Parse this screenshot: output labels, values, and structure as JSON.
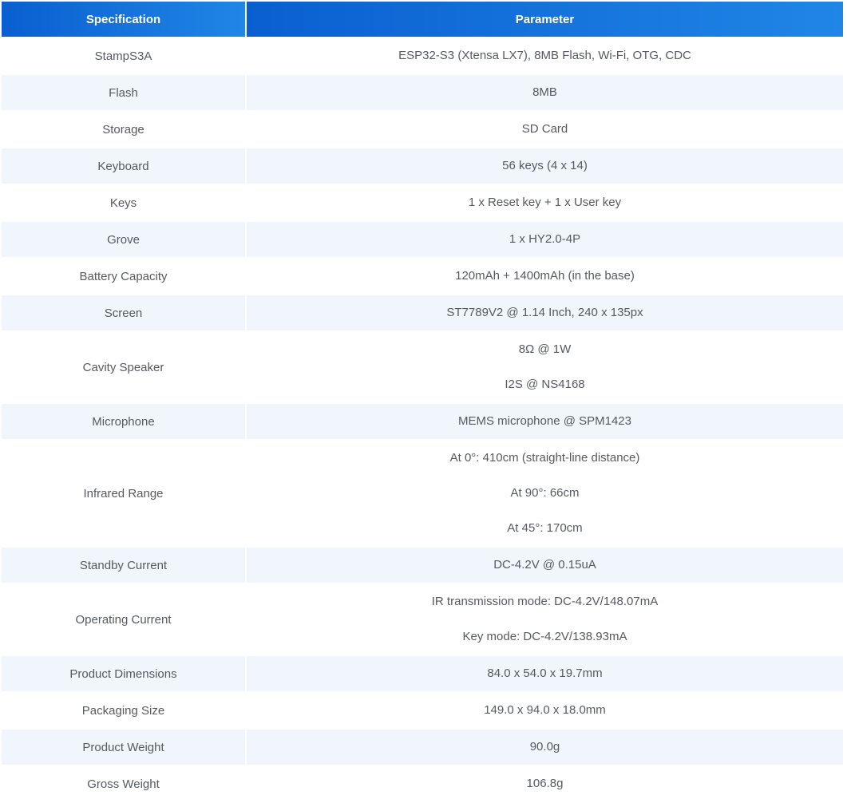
{
  "header": {
    "col1": "Specification",
    "col2": "Parameter"
  },
  "rows": [
    {
      "spec": "StampS3A",
      "params": [
        "ESP32-S3 (Xtensa LX7), 8MB Flash, Wi-Fi, OTG, CDC"
      ]
    },
    {
      "spec": "Flash",
      "params": [
        "8MB"
      ]
    },
    {
      "spec": "Storage",
      "params": [
        "SD Card"
      ]
    },
    {
      "spec": "Keyboard",
      "params": [
        "56 keys (4 x 14)"
      ]
    },
    {
      "spec": "Keys",
      "params": [
        "1 x Reset key + 1 x User key"
      ]
    },
    {
      "spec": "Grove",
      "params": [
        "1 x HY2.0-4P"
      ]
    },
    {
      "spec": "Battery Capacity",
      "params": [
        "120mAh + 1400mAh (in the base)"
      ]
    },
    {
      "spec": "Screen",
      "params": [
        "ST7789V2 @ 1.14 Inch, 240 x 135px"
      ]
    },
    {
      "spec": "Cavity Speaker",
      "params": [
        "8Ω @ 1W",
        "I2S @ NS4168"
      ]
    },
    {
      "spec": "Microphone",
      "params": [
        "MEMS microphone @ SPM1423"
      ]
    },
    {
      "spec": "Infrared Range",
      "params": [
        "At 0°: 410cm (straight-line distance)",
        "At 90°: 66cm",
        "At 45°: 170cm"
      ]
    },
    {
      "spec": "Standby Current",
      "params": [
        "DC-4.2V @ 0.15uA"
      ]
    },
    {
      "spec": "Operating Current",
      "params": [
        "IR transmission mode: DC-4.2V/148.07mA",
        "Key mode: DC-4.2V/138.93mA"
      ]
    },
    {
      "spec": "Product Dimensions",
      "params": [
        "84.0 x 54.0 x 19.7mm"
      ]
    },
    {
      "spec": "Packaging Size",
      "params": [
        "149.0 x 94.0 x 18.0mm"
      ]
    },
    {
      "spec": "Product Weight",
      "params": [
        "90.0g"
      ]
    },
    {
      "spec": "Gross Weight",
      "params": [
        "106.8g"
      ]
    }
  ]
}
